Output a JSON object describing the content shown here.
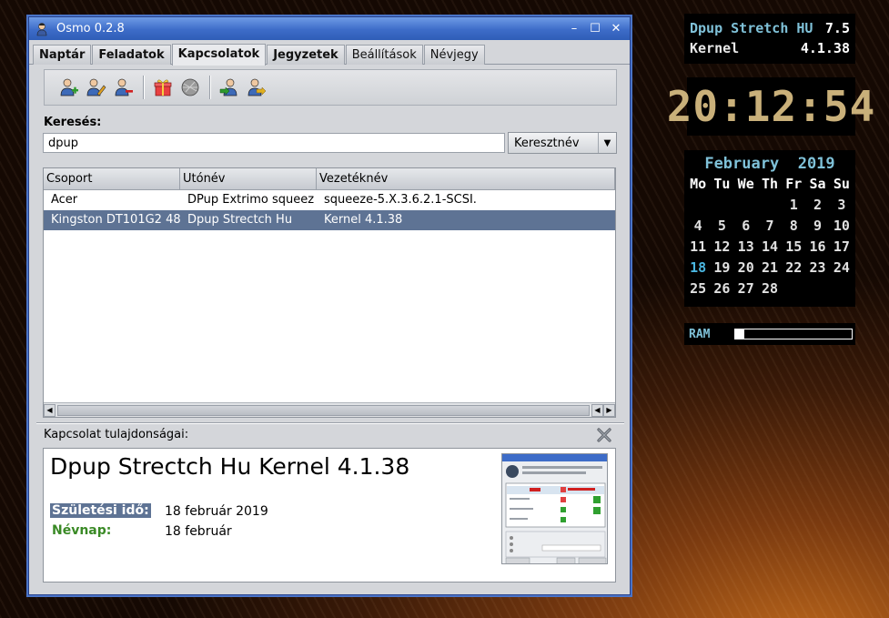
{
  "window": {
    "title": "Osmo 0.2.8",
    "minimize_glyph": "–",
    "maximize_glyph": "☐",
    "close_glyph": "✕"
  },
  "tabs": [
    {
      "label": "Naptár",
      "active": false,
      "bold": true
    },
    {
      "label": "Feladatok",
      "active": false,
      "bold": true
    },
    {
      "label": "Kapcsolatok",
      "active": true,
      "bold": true
    },
    {
      "label": "Jegyzetek",
      "active": false,
      "bold": true
    },
    {
      "label": "Beállítások",
      "active": false,
      "bold": false
    },
    {
      "label": "Névjegy",
      "active": false,
      "bold": false
    }
  ],
  "toolbar": {
    "icons": [
      "add-contact-icon",
      "edit-contact-icon",
      "remove-contact-icon",
      "birthdays-icon",
      "map-icon",
      "import-icon",
      "export-icon"
    ]
  },
  "search": {
    "label": "Keresés:",
    "value": "dpup",
    "field_select": "Keresztnév",
    "dropdown_glyph": "▼"
  },
  "table": {
    "columns": [
      "Csoport",
      "Utónév",
      "Vezetéknév"
    ],
    "rows": [
      {
        "group": "Acer",
        "first_name": "DPup Extrimo squeez",
        "last_name": "squeeze-5.X.3.6.2.1-SCSI.",
        "selected": false
      },
      {
        "group": "Kingston DT101G2 48",
        "first_name": "Dpup Strectch Hu",
        "last_name": "Kernel 4.1.38",
        "selected": true
      }
    ],
    "scroll_left_glyph": "◀",
    "scroll_right_glyph": "▶"
  },
  "properties": {
    "label": "Kapcsolat tulajdonságai:",
    "close_glyph": "✖",
    "title": "Dpup Strectch Hu Kernel 4.1.38",
    "birth_label": "Születési idő:",
    "birth_value": "18 február 2019",
    "nameday_label": "Névnap:",
    "nameday_value": "18 február"
  },
  "conky": {
    "system_name": "Dpup Stretch HU",
    "system_version": "7.5",
    "kernel_label": "Kernel",
    "kernel_version": "4.1.38",
    "clock": "20:12:54",
    "calendar": {
      "month": "February",
      "year": "2019",
      "weekdays": [
        "Mo",
        "Tu",
        "We",
        "Th",
        "Fr",
        "Sa",
        "Su"
      ],
      "first_weekday_index": 4,
      "days_in_month": 28,
      "today": 18
    },
    "ram_label": "RAM",
    "ram_usage_fraction": 0.08
  },
  "colors": {
    "titlebar": "#3d6cc8",
    "selection": "#5e7394",
    "nameday_green": "#3a8a26",
    "conky_cyan": "#7fc1d8",
    "clock_gold": "#c9b07a"
  }
}
